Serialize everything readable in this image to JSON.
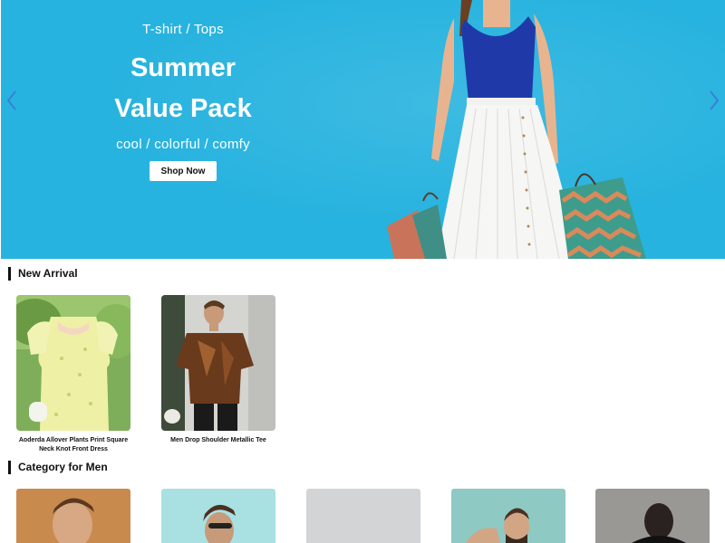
{
  "hero": {
    "eyebrow": "T-shirt / Tops",
    "title_line1": "Summer",
    "title_line2": "Value Pack",
    "subtitle": "cool / colorful / comfy",
    "cta_label": "Shop Now",
    "background_color": "#27b3df",
    "prev_icon": "chevron-left-icon",
    "next_icon": "chevron-right-icon"
  },
  "new_arrival": {
    "title": "New Arrival",
    "products": [
      {
        "name": "Aoderda Allover Plants Print Square Neck Knot Front Dress"
      },
      {
        "name": "Men Drop Shoulder Metallic Tee"
      }
    ]
  },
  "category_men": {
    "title": "Category for Men",
    "items": 5
  },
  "colors": {
    "accent_dark": "#111111",
    "arrow_blue": "#3a7fd9"
  }
}
